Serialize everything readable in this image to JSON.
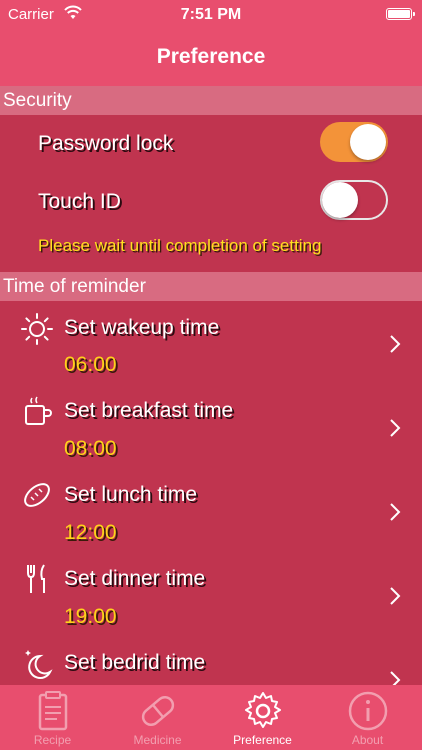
{
  "status_bar": {
    "carrier": "Carrier",
    "time": "7:51 PM"
  },
  "nav": {
    "title": "Preference"
  },
  "security": {
    "header": "Security",
    "password_lock": {
      "label": "Password lock",
      "on": true
    },
    "touch_id": {
      "label": "Touch ID",
      "on": false
    },
    "warning": "Please wait until completion of setting"
  },
  "reminders": {
    "header": "Time of reminder",
    "items": [
      {
        "label": "Set wakeup time",
        "time": "06:00",
        "icon": "sun-icon"
      },
      {
        "label": "Set breakfast time",
        "time": "08:00",
        "icon": "coffee-cup-icon"
      },
      {
        "label": "Set lunch time",
        "time": "12:00",
        "icon": "bread-icon"
      },
      {
        "label": "Set dinner time",
        "time": "19:00",
        "icon": "fork-knife-icon"
      },
      {
        "label": "Set bedrid time",
        "icon": "moon-stars-icon"
      }
    ]
  },
  "tabs": [
    {
      "label": "Recipe",
      "icon": "clipboard-icon",
      "active": false
    },
    {
      "label": "Medicine",
      "icon": "pill-icon",
      "active": false
    },
    {
      "label": "Preference",
      "icon": "gear-icon",
      "active": true
    },
    {
      "label": "About",
      "icon": "info-icon",
      "active": false
    }
  ],
  "colors": {
    "background": "#c0344f",
    "bar": "#e84e6e",
    "section_header": "#d86b81",
    "toggle_on": "#f39339",
    "time_text": "#ffd21a",
    "warning_text": "#ffe01e"
  }
}
